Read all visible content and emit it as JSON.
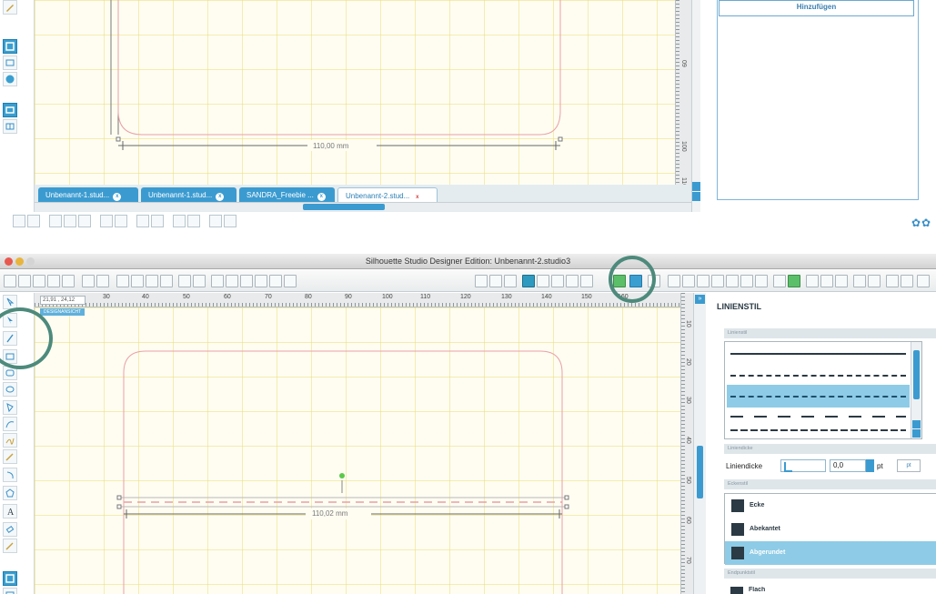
{
  "top_window": {
    "vruler_labels": [
      "09",
      "100",
      "110"
    ],
    "dimension_label": "110,00 mm",
    "tabs": [
      {
        "label": "Unbenannt-1.stud...",
        "close": "x"
      },
      {
        "label": "Unbenannt-1.stud...",
        "close": "x"
      },
      {
        "label": "SANDRA_Freebie ...",
        "close": "x"
      },
      {
        "label": "Unbenannt-2.stud...",
        "close": "x",
        "active": true
      }
    ],
    "panel": {
      "add_button": "Hinzufügen"
    },
    "gear_icons": "✿✿"
  },
  "bottom_window": {
    "title": "Silhouette Studio Designer Edition: Unbenannt-2.studio3",
    "coord_readout": "21,91 , 24,12",
    "design_view_label": "DESIGNANSICHT",
    "ruler_labels": [
      "30",
      "40",
      "50",
      "60",
      "70",
      "80",
      "90",
      "100",
      "110",
      "120",
      "130",
      "140",
      "150",
      "160"
    ],
    "vruler_labels": [
      "10",
      "20",
      "30",
      "40",
      "50",
      "60",
      "70"
    ],
    "dimension_label": "110,02 mm",
    "expand_glyph": "»"
  },
  "panel": {
    "title": "LINIENSTIL",
    "sections": {
      "line_style": "Linienstil",
      "line_thickness": "Liniendicke",
      "corner_style": "Eckenstil",
      "end_style": "Endpunktstil"
    },
    "thickness_label": "Liniendicke",
    "thickness_value": "0,0",
    "thickness_unit": "pt",
    "unit_button": "pt",
    "corners": [
      {
        "label": "Ecke",
        "selected": false
      },
      {
        "label": "Abekantet",
        "selected": false
      },
      {
        "label": "Abgerundet",
        "selected": true
      }
    ],
    "end_item_label": "Flach"
  },
  "colors": {
    "accent": "#3b9bd0",
    "highlight": "#8ecbe6",
    "annotation_circle": "#4d8a7c",
    "shape_outline": "#e8a0a8",
    "grid": "#ebde78"
  }
}
